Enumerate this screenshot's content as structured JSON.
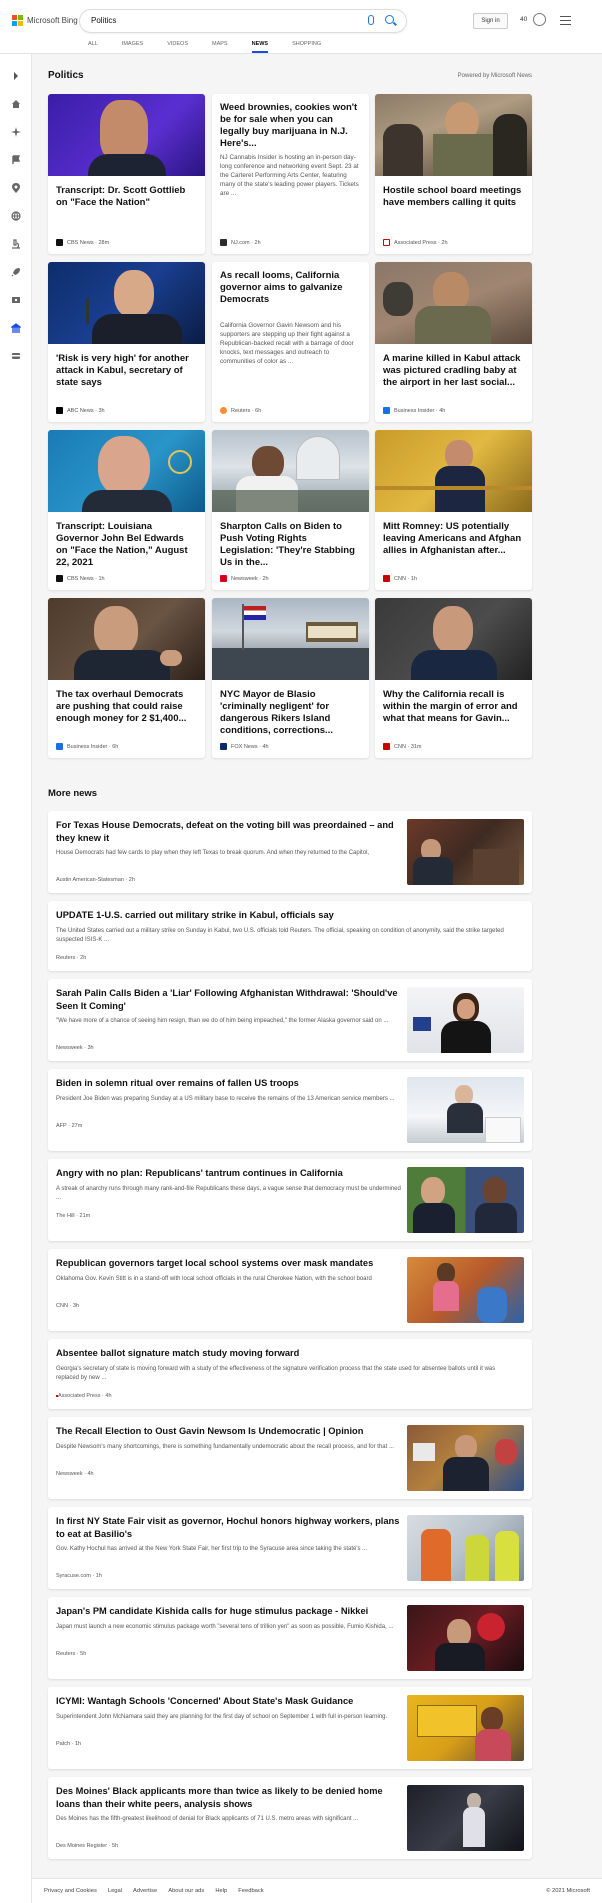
{
  "brand": {
    "name": "Microsoft Bing"
  },
  "search": {
    "query": "Politics"
  },
  "header": {
    "signin_label": "Sign in",
    "rewards_count": "40"
  },
  "tabs": [
    {
      "label": "ALL"
    },
    {
      "label": "IMAGES"
    },
    {
      "label": "VIDEOS"
    },
    {
      "label": "MAPS"
    },
    {
      "label": "NEWS"
    },
    {
      "label": "SHOPPING"
    }
  ],
  "section": {
    "title": "Politics",
    "powered": "Powered by Microsoft News"
  },
  "cards": [
    {
      "title": "Transcript: Dr. Scott Gottlieb on \"Face the Nation\"",
      "source": "CBS News",
      "time": "28m"
    },
    {
      "title": "Weed brownies, cookies won't be for sale when you can legally buy marijuana in N.J. Here's...",
      "body": "NJ Cannabis Insider is hosting an in-person day-long conference and networking event Sept. 23 at the Carteret Performing Arts Center, featuring many of the state's leading power players. Tickets are ...",
      "source": "NJ.com",
      "time": "2h"
    },
    {
      "title": "Hostile school board meetings have members calling it quits",
      "source": "Associated Press",
      "time": "2h"
    },
    {
      "title": "'Risk is very high' for another attack in Kabul, secretary of state says",
      "source": "ABC News",
      "time": "3h"
    },
    {
      "title": "As recall looms, California governor aims to galvanize Democrats",
      "body": "California Governor Gavin Newsom and his supporters are stepping up their fight against a Republican-backed recall with a barrage of door knocks, text messages and outreach to communities of color as ...",
      "source": "Reuters",
      "time": "6h"
    },
    {
      "title": "A marine killed in Kabul attack was pictured cradling baby at the airport in her last social...",
      "source": "Business Insider",
      "time": "4h"
    },
    {
      "title": "Transcript: Louisiana Governor John Bel Edwards on \"Face the Nation,\" August 22, 2021",
      "source": "CBS News",
      "time": "1h"
    },
    {
      "title": "Sharpton Calls on Biden to Push Voting Rights Legislation: 'They're Stabbing Us in the...",
      "source": "Newsweek",
      "time": "2h"
    },
    {
      "title": "Mitt Romney: US potentially leaving Americans and Afghan allies in Afghanistan after...",
      "source": "CNN",
      "time": "1h"
    },
    {
      "title": "The tax overhaul Democrats are pushing that could raise enough money for 2 $1,400...",
      "source": "Business Insider",
      "time": "6h"
    },
    {
      "title": "NYC Mayor de Blasio 'criminally negligent' for dangerous Rikers Island conditions, corrections...",
      "source": "FOX News",
      "time": "4h"
    },
    {
      "title": "Why the California recall is within the margin of error and what that means for Gavin...",
      "source": "CNN",
      "time": "31m"
    }
  ],
  "more_news": {
    "title": "More news",
    "items": [
      {
        "title": "For Texas House Democrats, defeat on the voting bill was preordained – and they knew it",
        "body": "House Democrats had few cards to play when they left Texas to break quorum. And when they returned to the Capitol,",
        "source": "Austin American-Statesman",
        "time": "2h"
      },
      {
        "title": "UPDATE 1-U.S. carried out military strike in Kabul, officials say",
        "body": "The United States carried out a military strike on Sunday in Kabul, two U.S. officials told Reuters. The official, speaking on condition of anonymity, said the strike targeted suspected ISIS-K ...",
        "source": "Reuters",
        "time": "2h"
      },
      {
        "title": "Sarah Palin Calls Biden a 'Liar' Following Afghanistan Withdrawal: 'Should've Seen It Coming'",
        "body": "\"We have more of a chance of seeing him resign, than we do of him being impeached,\" the former Alaska governor said on ...",
        "source": "Newsweek",
        "time": "3h"
      },
      {
        "title": "Biden in solemn ritual over remains of fallen US troops",
        "body": "President Joe Biden was preparing Sunday at a US military base to receive the remains of the 13 American service members ...",
        "source": "AFP",
        "time": "27m"
      },
      {
        "title": "Angry with no plan: Republicans' tantrum continues in California",
        "body": "A streak of anarchy runs through many rank-and-file Republicans these days, a vague sense that democracy must be undermined ...",
        "source": "The Hill",
        "time": "21m"
      },
      {
        "title": "Republican governors target local school systems over mask mandates",
        "body": "Oklahoma Gov. Kevin Stitt is in a stand-off with local school officials in the rural Cherokee Nation, with the school board",
        "source": "CNN",
        "time": "3h"
      },
      {
        "title": "Absentee ballot signature match study moving forward",
        "body": "Georgia's secretary of state is moving forward with a study of the effectiveness of the signature verification process that the state used for absentee ballots until it was replaced by new ...",
        "source": "Associated Press",
        "time": "4h"
      },
      {
        "title": "The Recall Election to Oust Gavin Newsom Is Undemocratic | Opinion",
        "body": "Despite Newsom's many shortcomings, there is something fundamentally undemocratic about the recall process, and for that ...",
        "source": "Newsweek",
        "time": "4h"
      },
      {
        "title": "In first NY State Fair visit as governor, Hochul honors highway workers, plans to eat at Basilio's",
        "body": "Gov. Kathy Hochul has arrived at the New York State Fair, her first trip to the Syracuse area since taking the state's ...",
        "source": "Syracuse.com",
        "time": "1h"
      },
      {
        "title": "Japan's PM candidate Kishida calls for huge stimulus package - Nikkei",
        "body": "Japan must launch a new economic stimulus package worth \"several tens of trillion yen\" as soon as possible, Fumio Kishida, ...",
        "source": "Reuters",
        "time": "5h"
      },
      {
        "title": "ICYMI: Wantagh Schools 'Concerned' About State's Mask Guidance",
        "body": "Superintendent John McNamara said they are planning for the first day of school on September 1 with full in-person learning.",
        "source": "Patch",
        "time": "1h"
      },
      {
        "title": "Des Moines' Black applicants more than twice as likely to be denied home loans than their white peers, analysis shows",
        "body": "Des Moines has the fifth-greatest likelihood of denial for Black applicants of 71 U.S. metro areas with significant ...",
        "source": "Des Moines Register",
        "time": "5h"
      }
    ]
  },
  "footer": {
    "links": [
      "Privacy and Cookies",
      "Legal",
      "Advertise",
      "About our ads",
      "Help",
      "Feedback"
    ],
    "copyright": "© 2021 Microsoft"
  },
  "colors": {
    "accent": "#174ae4",
    "page_bg": "#f5f5f5"
  }
}
